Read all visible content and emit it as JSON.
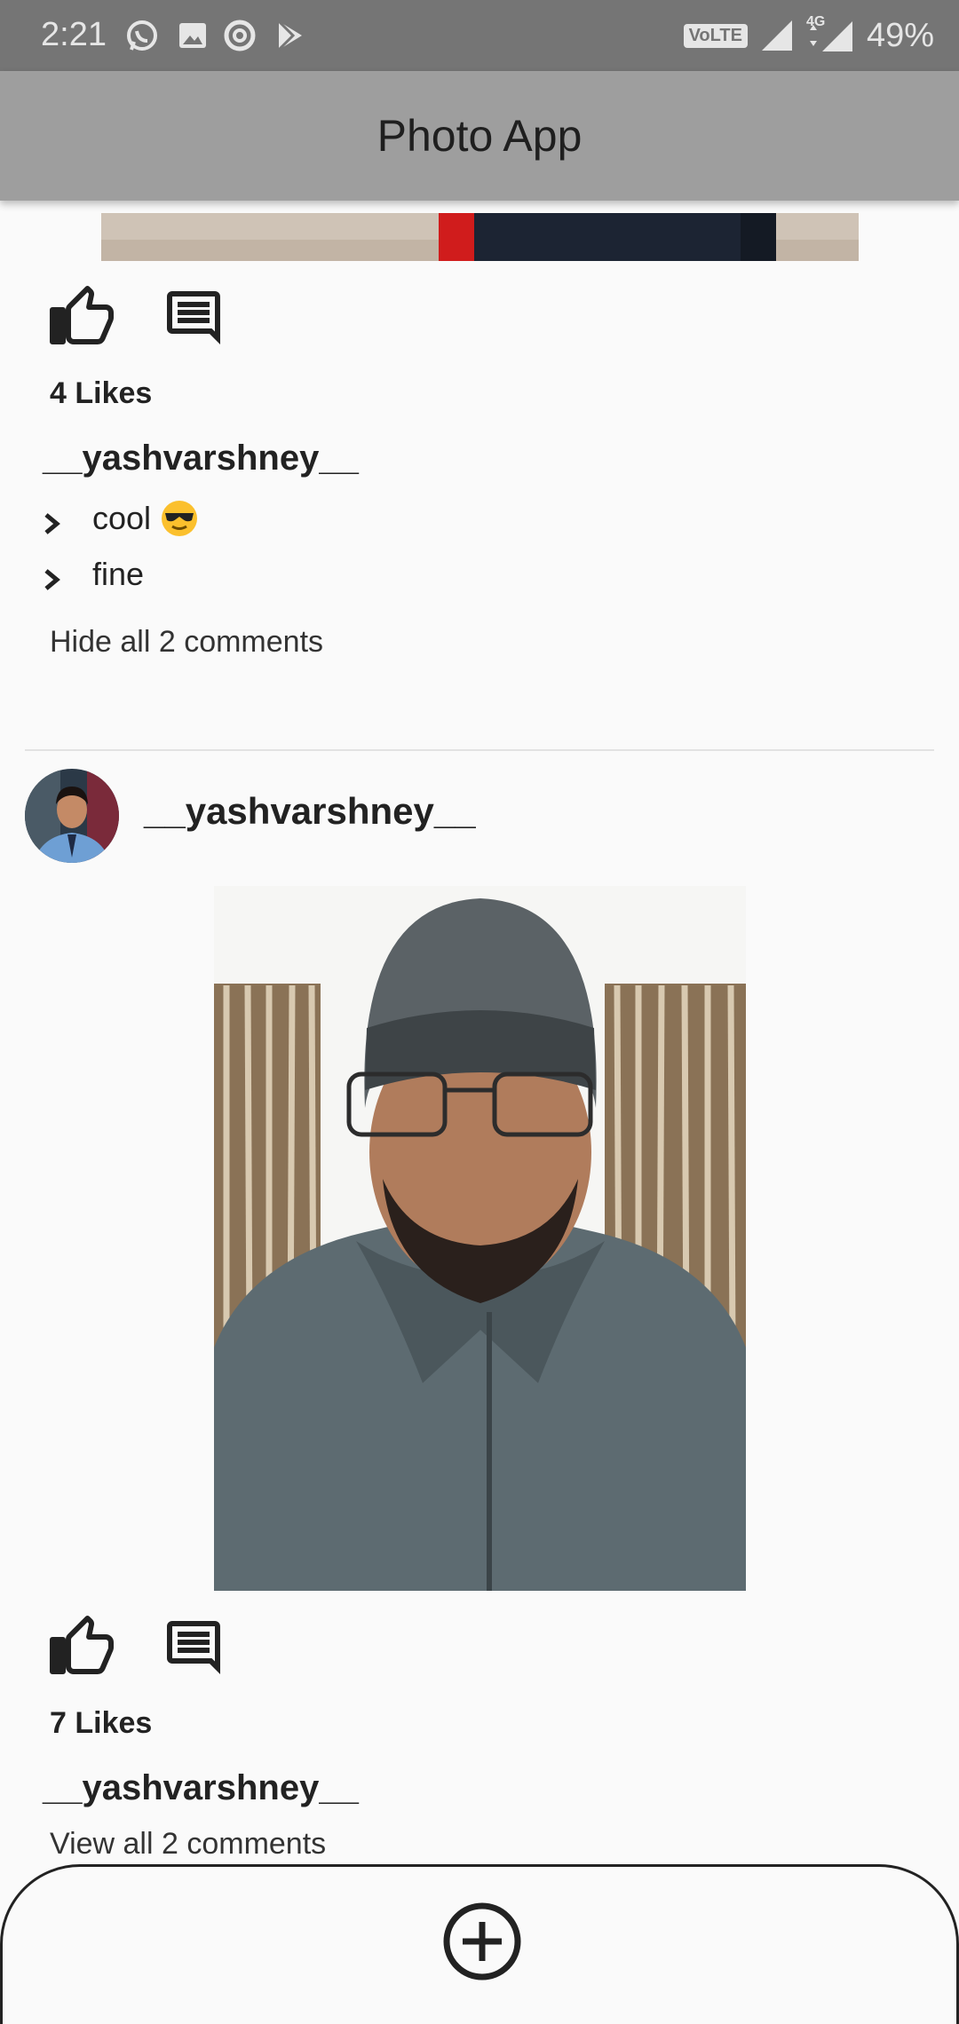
{
  "status_bar": {
    "time": "2:21",
    "network_badge": "VoLTE",
    "network_type": "4G",
    "battery": "49%",
    "notification_icons": [
      "whatsapp-icon",
      "image-icon",
      "circle-a-icon",
      "play-store-icon"
    ]
  },
  "app_bar": {
    "title": "Photo App"
  },
  "post1": {
    "likes_text": "4 Likes",
    "author": "__yashvarshney__",
    "comments": [
      {
        "text": "cool",
        "emoji": "sunglasses-emoji"
      },
      {
        "text": "fine"
      }
    ],
    "toggle_comments": "Hide all 2 comments"
  },
  "post2": {
    "author_header": "__yashvarshney__",
    "likes_text": "7 Likes",
    "author": "__yashvarshney__",
    "toggle_comments": "View all 2 comments"
  },
  "bottom_bar": {
    "add_icon": "add-circle-icon"
  },
  "colors": {
    "status_bar": "#757575",
    "app_bar": "#9e9e9e",
    "background": "#fafafa",
    "text": "#1c1c1c"
  }
}
